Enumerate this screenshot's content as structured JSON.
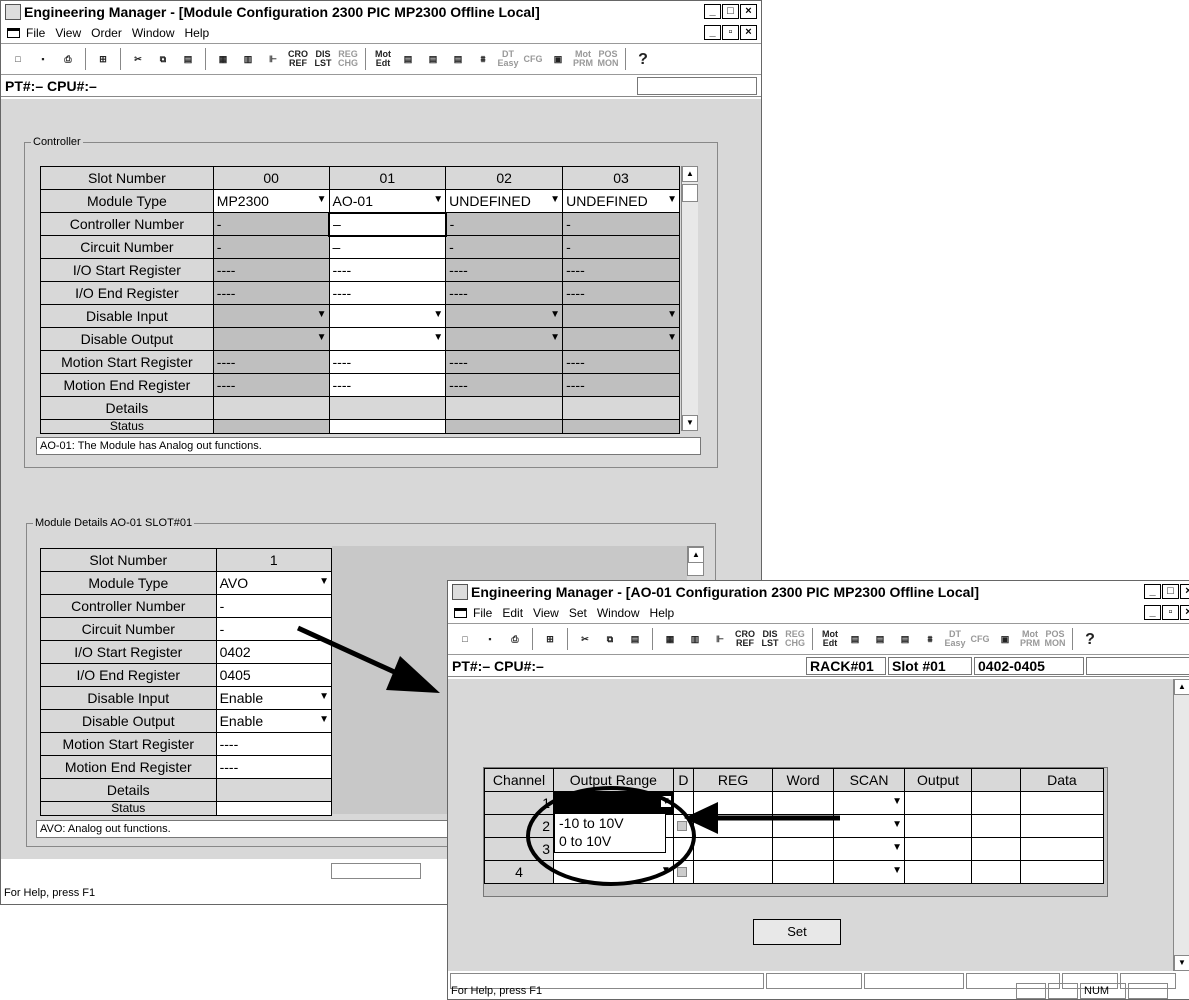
{
  "win1": {
    "title": "Engineering Manager - [Module Configuration   2300 PIC MP2300   Offline Local]",
    "menu": [
      "File",
      "View",
      "Order",
      "Window",
      "Help"
    ],
    "info": "PT#:– CPU#:–",
    "controller": {
      "legend": "Controller",
      "row_labels": [
        "Slot Number",
        "Module Type",
        "Controller Number",
        "Circuit Number",
        "I/O Start Register",
        "I/O End Register",
        "Disable Input",
        "Disable Output",
        "Motion Start Register",
        "Motion End Register",
        "Details",
        "Status"
      ],
      "columns": [
        {
          "slot": "00",
          "type": "MP2300",
          "ctrl": "-",
          "circ": "-",
          "ios": "----",
          "ioe": "----",
          "ms": "----",
          "me": "----"
        },
        {
          "slot": "01",
          "type": "AO-01",
          "ctrl": "–",
          "circ": "–",
          "ios": "----",
          "ioe": "----",
          "ms": "----",
          "me": "----"
        },
        {
          "slot": "02",
          "type": "UNDEFINED",
          "ctrl": "-",
          "circ": "-",
          "ios": "----",
          "ioe": "----",
          "ms": "----",
          "me": "----"
        },
        {
          "slot": "03",
          "type": "UNDEFINED",
          "ctrl": "-",
          "circ": "-",
          "ios": "----",
          "ioe": "----",
          "ms": "----",
          "me": "----"
        }
      ],
      "description": "AO-01: The Module has Analog out functions."
    },
    "details": {
      "legend": "Module Details  AO-01  SLOT#01",
      "slot": "1",
      "type": "AVO",
      "ctrl": "-",
      "circ": "-",
      "ios": "0402",
      "ioe": "0405",
      "din": "Enable",
      "dout": "Enable",
      "ms": "----",
      "me": "----",
      "description": "AVO: Analog out functions."
    },
    "status": "For Help, press F1"
  },
  "win2": {
    "title": "Engineering Manager - [AO-01 Configuration   2300 PIC MP2300   Offline Local]",
    "menu": [
      "File",
      "Edit",
      "View",
      "Set",
      "Window",
      "Help"
    ],
    "info": "PT#:– CPU#:–",
    "rack": "RACK#01",
    "slot": "Slot #01",
    "range": "0402-0405",
    "headers": [
      "Channel",
      "Output Range",
      "D",
      "REG",
      "Word",
      "SCAN",
      "Output",
      "",
      "Data"
    ],
    "channels": [
      "1",
      "2",
      "3",
      "4"
    ],
    "options": [
      "-10 to 10V",
      "0 to 10V"
    ],
    "set_label": "Set",
    "status": "For Help, press F1",
    "num": "NUM"
  },
  "toolbar": {
    "labels": [
      "CRO REF",
      "DIS LST",
      "REG CHG",
      "Mot Edt",
      "DT Easy",
      "CFG",
      "Mot PRM",
      "POS MON",
      "?"
    ]
  }
}
